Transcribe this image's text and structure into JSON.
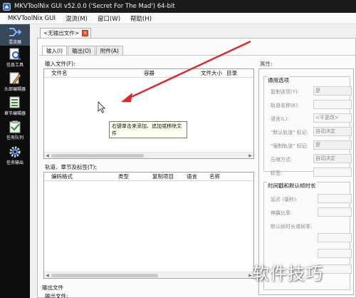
{
  "window": {
    "title": "MKVToolNix GUI v52.0.0 ('Secret For The Mad') 64-bit"
  },
  "menu": [
    "MKVToolNix GUI",
    "混流(M)",
    "窗口(W)",
    "帮助(H)"
  ],
  "sidebar": {
    "items": [
      {
        "label": "混流器",
        "icon": "merge-icon",
        "active": true
      },
      {
        "label": "信息工具",
        "icon": "info-tool-icon",
        "active": false
      },
      {
        "label": "头部编辑器",
        "icon": "header-editor-icon",
        "active": false
      },
      {
        "label": "章节编辑器",
        "icon": "chapter-editor-icon",
        "active": false
      },
      {
        "label": "任务队列",
        "icon": "job-queue-icon",
        "active": false
      },
      {
        "label": "任务输出",
        "icon": "job-output-icon",
        "active": false
      }
    ]
  },
  "doc_tab": {
    "label": "<无输出文件>",
    "close": "×"
  },
  "sub_tabs": [
    "输入(I)",
    "输出(O)",
    "附件(A)"
  ],
  "input": {
    "section_label": "输入文件(F):",
    "columns": [
      "文件名",
      "容器",
      "文件大小",
      "目录"
    ],
    "tooltip": "右键单击来添加、追加或移除文件"
  },
  "tracks": {
    "section_label": "轨道、章节及标签(T):",
    "columns": [
      "编码格式",
      "类型",
      "复制项目",
      "语言",
      "名称"
    ]
  },
  "properties": {
    "title": "属性:",
    "general": {
      "title": "通用选项",
      "rows": [
        {
          "label": "复制该项(Y):",
          "value": "是"
        },
        {
          "label": "轨道名称(K):",
          "value": ""
        },
        {
          "label": "语言(L):",
          "value": "<不更改>"
        },
        {
          "label": "\"默认轨道\" 标记:",
          "value": "自动决定"
        },
        {
          "label": "\"强制轨道\" 标记:",
          "value": "是"
        },
        {
          "label": "压缩方式:",
          "value": "自动决定"
        },
        {
          "label": "标签:",
          "value": ""
        }
      ]
    },
    "timing": {
      "title": "时间戳和默认帧时长",
      "rows": [
        {
          "label": "延迟 (毫秒):",
          "value": ""
        },
        {
          "label": "伸展比率:",
          "value": ""
        },
        {
          "label": "默认帧时长或帧率:",
          "value": ""
        }
      ]
    }
  },
  "output": {
    "group_label": "输出文件",
    "file_label": "输出文件:"
  },
  "watermark": "软件技巧",
  "colors": {
    "arrow": "#d82a2a",
    "sidebar_bg": "#0d0d0d",
    "sidebar_active": "#39475a",
    "close_button": "#e8512f"
  }
}
